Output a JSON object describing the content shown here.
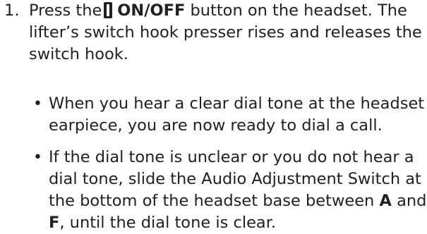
{
  "step": {
    "number": "1.",
    "line1_before": "Press the",
    "button_icon": "on-off-button-icon",
    "line1_bold": "ON/OFF",
    "line1_after": "button on the headset. The",
    "line2": "lifter’s switch hook presser rises and releases the",
    "line3": "switch hook."
  },
  "bullets": [
    {
      "marker": "•",
      "lines": [
        "When you hear a clear dial tone at the headset",
        "earpiece, you are now ready to dial a call."
      ]
    },
    {
      "marker": "•",
      "lines": [
        "If the dial tone is unclear or you do not hear a",
        "dial tone, slide the Audio Adjustment Switch at",
        "the bottom of the headset base between"
      ],
      "line3_bold": "A",
      "line3_after": "and",
      "line4_bold": "F",
      "line4_after": ", until the dial tone is clear."
    }
  ]
}
